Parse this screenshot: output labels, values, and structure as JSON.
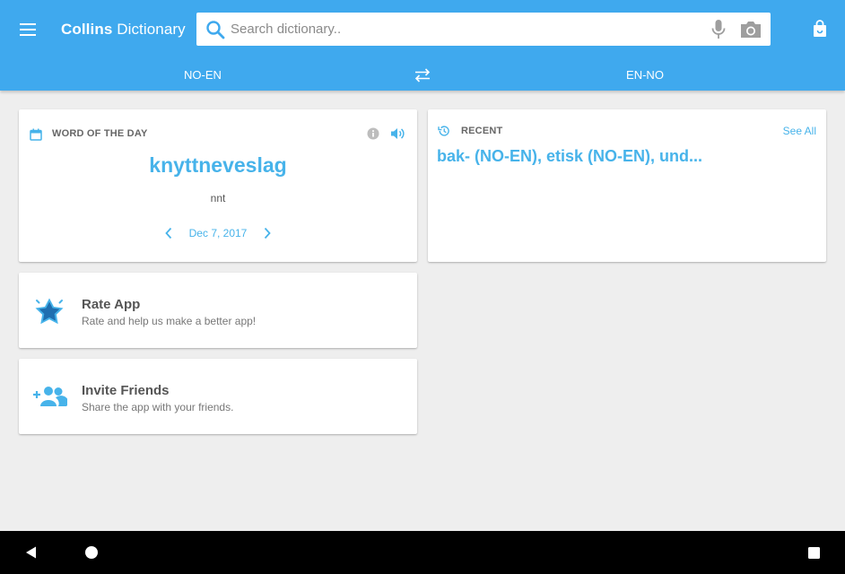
{
  "app": {
    "title_bold": "Collins",
    "title_rest": " Dictionary"
  },
  "search": {
    "value": "",
    "placeholder": "Search dictionary.."
  },
  "icons": {
    "menu": "menu-icon",
    "search": "search-icon",
    "mic": "microphone-icon",
    "camera": "camera-icon",
    "shop": "shopping-bag-icon",
    "swap": "swap-arrows-icon",
    "calendar": "calendar-icon",
    "info": "info-icon",
    "speaker": "speaker-icon",
    "history": "history-icon",
    "star": "star-badge-icon",
    "add_people": "add-people-icon"
  },
  "colors": {
    "brand": "#3fa9ee",
    "accent": "#47b3ea",
    "background": "#eeeeee"
  },
  "language_tabs": {
    "left": "NO-EN",
    "right": "EN-NO"
  },
  "word_of_the_day": {
    "heading": "WORD OF THE DAY",
    "word": "knyttneveslag",
    "part_of_speech": "nnt",
    "date": "Dec 7, 2017"
  },
  "recent": {
    "heading": "RECENT",
    "see_all": "See All",
    "words": "bak- (NO-EN), etisk (NO-EN), und..."
  },
  "rate_app": {
    "title": "Rate App",
    "subtitle": "Rate and help us make a better app!"
  },
  "invite_friends": {
    "title": "Invite Friends",
    "subtitle": "Share the app with your friends."
  }
}
